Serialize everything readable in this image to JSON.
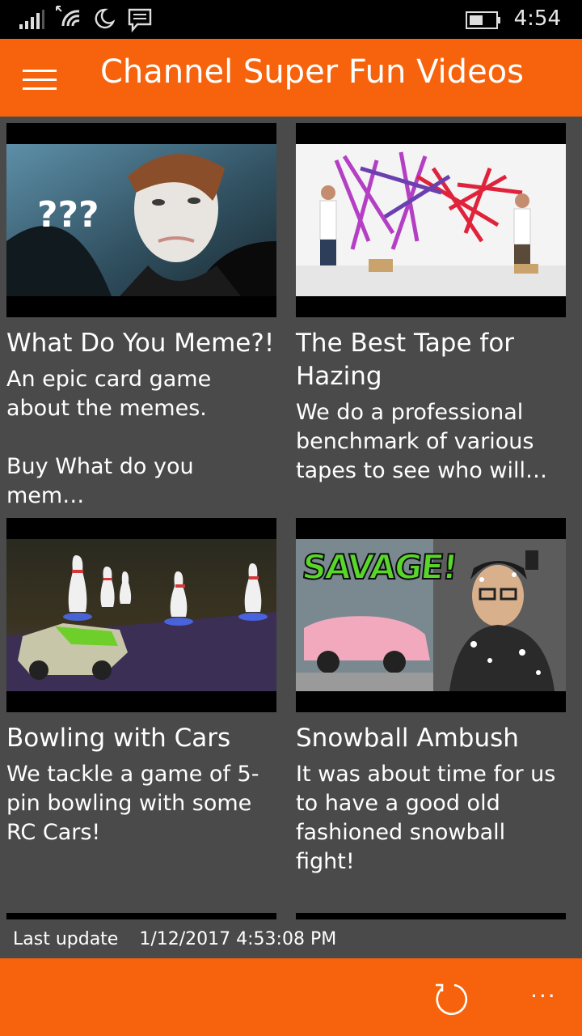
{
  "status_bar": {
    "time": "4:54",
    "icons": [
      "signal-icon",
      "wifi-icon",
      "quiet-hours-icon",
      "message-icon",
      "battery-icon"
    ]
  },
  "header": {
    "title": "Channel Super Fun Videos",
    "menu_icon": "hamburger-icon",
    "background": "#f7630c"
  },
  "videos": [
    {
      "title": "What Do You Meme?!",
      "description": "An epic card game about the memes.\n\nBuy What do you mem…",
      "thumbnail_text": "???"
    },
    {
      "title": "The Best Tape for Hazing",
      "description": "We do a professional benchmark of various tapes to see who will…"
    },
    {
      "title": "Bowling with Cars",
      "description": "We tackle a game of 5-pin bowling with some RC Cars!"
    },
    {
      "title": "Snowball Ambush",
      "description": "It was about time for us to have a good old fashioned snowball fight!",
      "thumbnail_text": "SAVAGE!"
    }
  ],
  "footer": {
    "last_update_label": "Last update",
    "last_update_value": "1/12/2017 4:53:08 PM"
  },
  "app_bar": {
    "refresh_icon": "refresh-icon",
    "more_label": "···"
  }
}
